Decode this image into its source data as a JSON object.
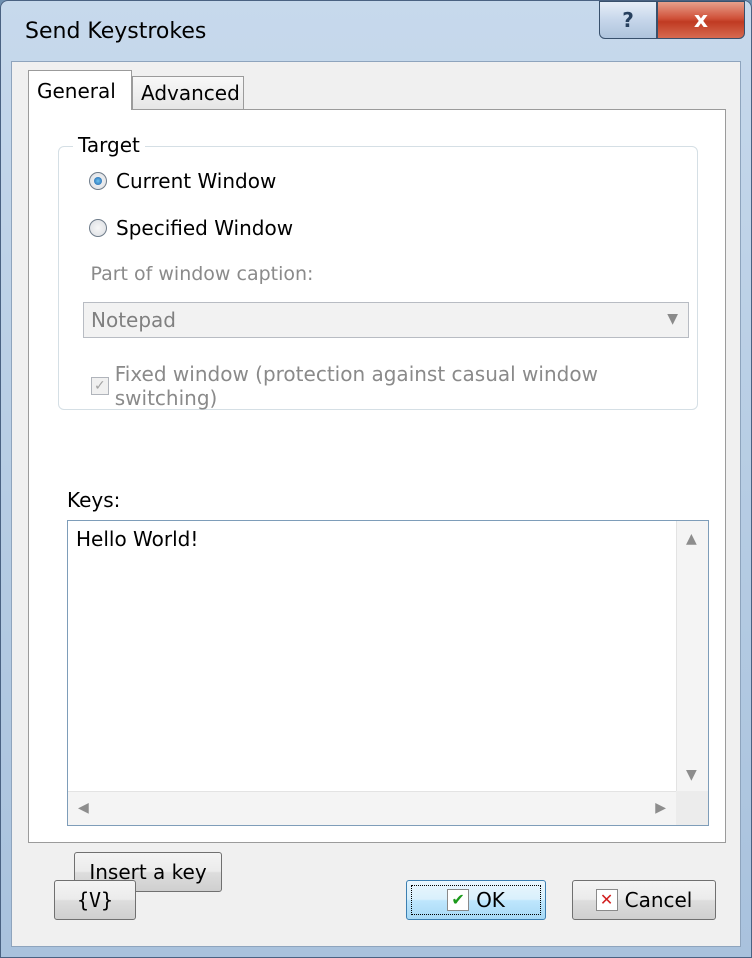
{
  "window": {
    "title": "Send Keystrokes",
    "help_label": "?",
    "close_label": "x"
  },
  "tabs": [
    {
      "label": "General",
      "active": true
    },
    {
      "label": "Advanced",
      "active": false
    }
  ],
  "target": {
    "group_label": "Target",
    "current_window_label": "Current Window",
    "specified_window_label": "Specified Window",
    "selected": "Current Window",
    "caption_label": "Part of window caption:",
    "caption_value": "Notepad",
    "fixed_window_label": "Fixed window (protection against casual window switching)",
    "fixed_window_checked": true
  },
  "keys": {
    "label": "Keys:",
    "value": "Hello World!"
  },
  "buttons": {
    "insert_key": "Insert a key",
    "variables": "{V}",
    "ok": "OK",
    "cancel": "Cancel"
  },
  "icons": {
    "ok": "check-icon",
    "cancel": "x-icon"
  }
}
